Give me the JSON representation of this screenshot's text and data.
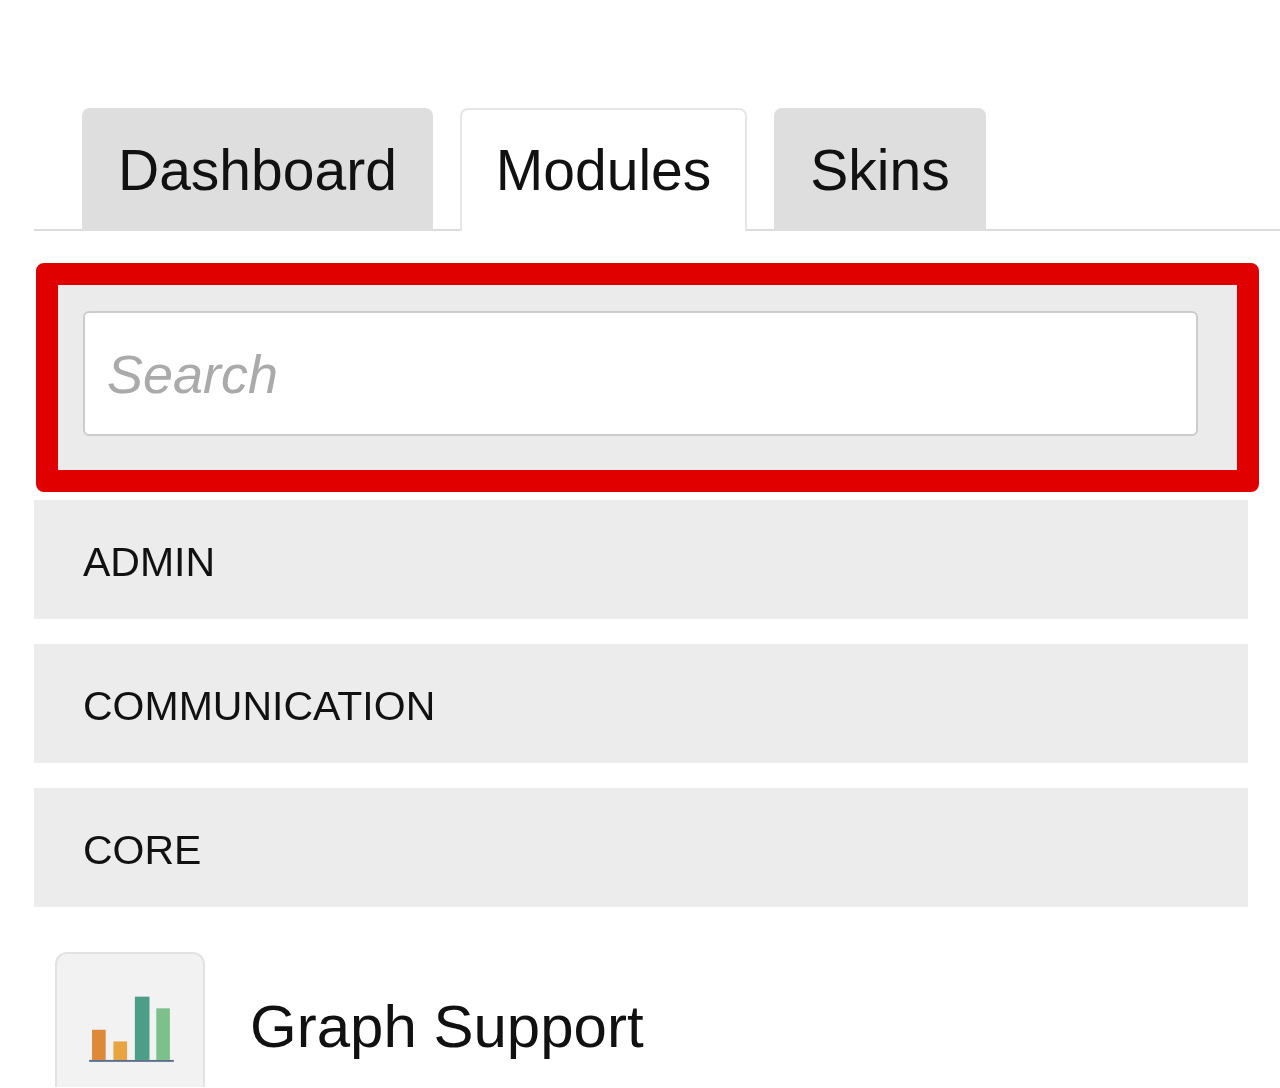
{
  "tabs": [
    {
      "label": "Dashboard",
      "selected": false
    },
    {
      "label": "Modules",
      "selected": true
    },
    {
      "label": "Skins",
      "selected": false
    }
  ],
  "search": {
    "placeholder": "Search",
    "highlighted": true
  },
  "categories": [
    {
      "label": "ADMIN"
    },
    {
      "label": "COMMUNICATION"
    },
    {
      "label": "CORE"
    }
  ],
  "modules": [
    {
      "name": "Graph Support"
    }
  ]
}
